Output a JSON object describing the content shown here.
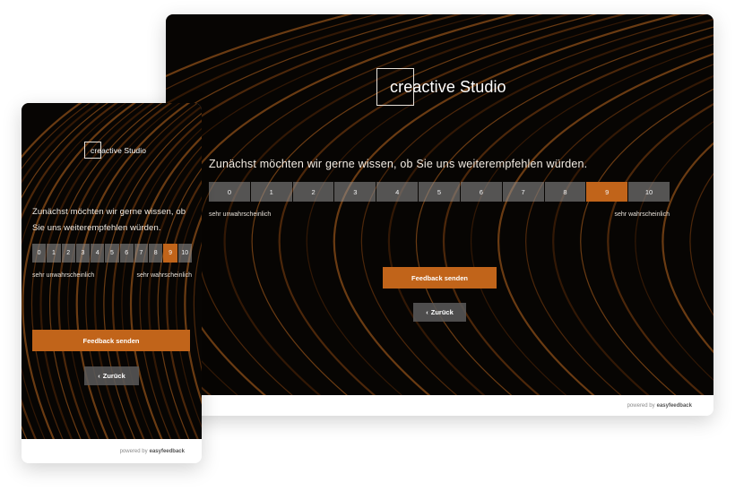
{
  "brand": {
    "name": "creactive Studio",
    "accent_color": "#c1641a"
  },
  "survey": {
    "question": "Zunächst möchten wir gerne wissen, ob Sie uns weiterempfehlen würden.",
    "scale": [
      "0",
      "1",
      "2",
      "3",
      "4",
      "5",
      "6",
      "7",
      "8",
      "9",
      "10"
    ],
    "selected_value": "9",
    "low_label": "sehr unwahrscheinlich",
    "high_label": "sehr wahrscheinlich"
  },
  "actions": {
    "submit_label": "Feedback senden",
    "back_label": "Zurück",
    "back_icon": "chevron-left-icon"
  },
  "footer": {
    "powered_by": "powered by",
    "provider": "easyfeedback"
  }
}
